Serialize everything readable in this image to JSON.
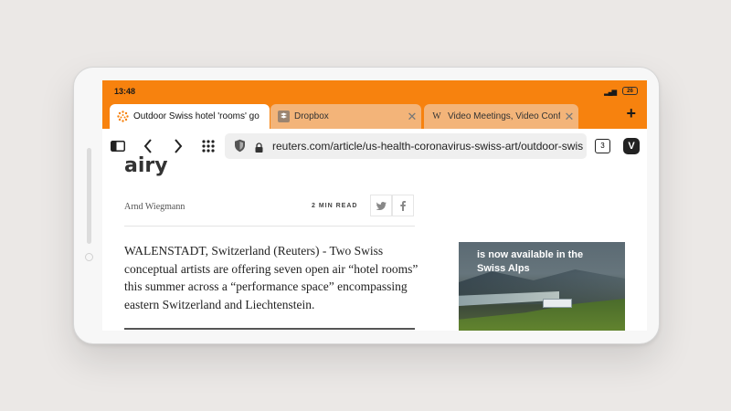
{
  "status_bar": {
    "time": "13:48",
    "battery": "26"
  },
  "tabs": [
    {
      "title": "Outdoor Swiss hotel 'rooms' go",
      "favicon": "reuters-icon",
      "active": true
    },
    {
      "title": "Dropbox",
      "favicon": "dropbox-icon",
      "active": false
    },
    {
      "title": "Video Meetings, Video Confer",
      "favicon": "W",
      "active": false
    }
  ],
  "new_tab_label": "+",
  "toolbar": {
    "url": "reuters.com/article/us-health-coronavirus-swiss-art/outdoor-swiss-h",
    "tab_count": "3",
    "vivaldi_label": "V"
  },
  "article": {
    "headline": "airy",
    "author": "Arnd Wiegmann",
    "read_time": "2 MIN READ",
    "body": "WALENSTADT, Switzerland (Reuters) - Two Swiss conceptual artists are offering seven open air “hotel rooms” this summer across a “performance space” encompassing eastern Switzerland and Liechtenstein."
  },
  "ad": {
    "text": "is now available in the Swiss Alps"
  },
  "colors": {
    "accent": "#f7820e",
    "inactive_tab": "#f3b479"
  }
}
